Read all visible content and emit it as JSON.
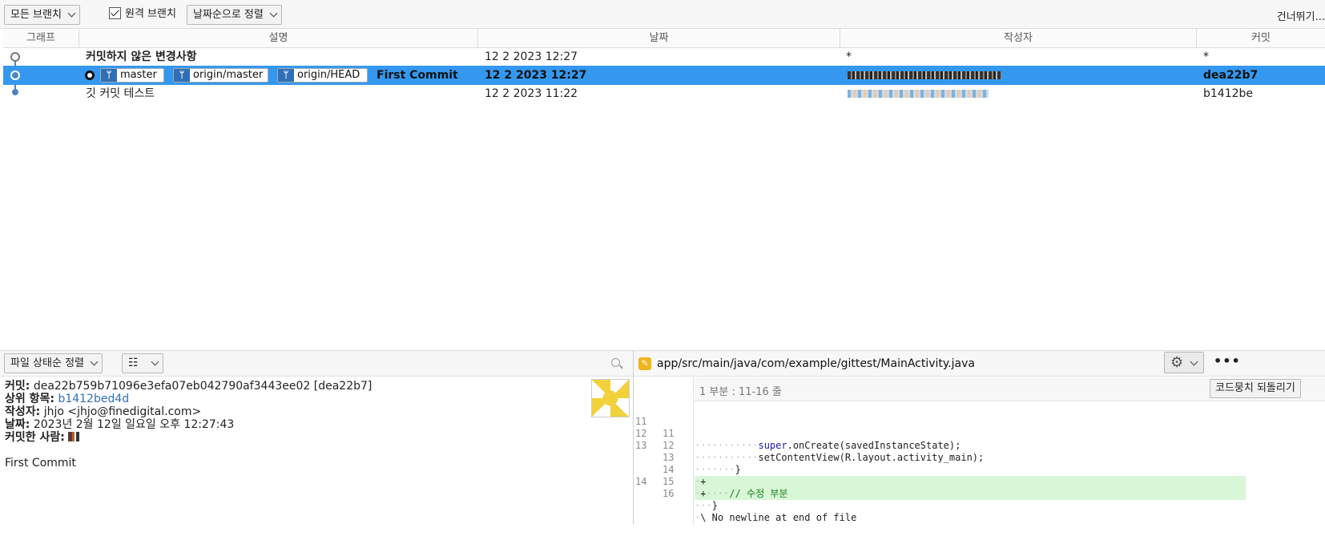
{
  "toolbar": {
    "branches_dropdown": "모든 브랜치",
    "remote_branches_label": "원격 브랜치",
    "sort_dropdown": "날짜순으로 정렬",
    "skip_label": "건너뛰기..."
  },
  "columns": {
    "graph": "그래프",
    "description": "설명",
    "date": "날짜",
    "author": "작성자",
    "commit": "커밋"
  },
  "commits": [
    {
      "description": "커밋하지 않은 변경사항",
      "date": "12 2 2023 12:27",
      "author": "*",
      "commit": "*"
    },
    {
      "refs": [
        "master",
        "origin/master",
        "origin/HEAD"
      ],
      "description": "First Commit",
      "date": "12 2 2023 12:27",
      "commit": "dea22b7"
    },
    {
      "description": "깃 커밋 테스트",
      "date": "12 2 2023 11:22",
      "commit": "b1412be"
    }
  ],
  "file_pane": {
    "sort_dropdown": "파일 상태순 정렬",
    "view_icon": "list-view-icon"
  },
  "details": {
    "commit_label": "커밋:",
    "commit_value": "dea22b759b71096e3efa07eb042790af3443ee02 [dea22b7]",
    "parent_label": "상위 항목:",
    "parent_value": "b1412bed4d",
    "author_label": "작성자:",
    "author_value": "jhjo <jhjo@finedigital.com>",
    "date_label": "날짜:",
    "date_value": "2023년 2월 12일 일요일 오후 12:27:43",
    "committer_label": "커밋한 사람:",
    "message": "First Commit"
  },
  "diff": {
    "file_path": "app/src/main/java/com/example/gittest/MainActivity.java",
    "hunk_title": "1 부분 : 11-16 줄",
    "revert_button": "코드뭉치 되돌리기",
    "more_label": "•••",
    "lines": [
      {
        "old": "11",
        "new": "11",
        "type": "ctx"
      },
      {
        "old": "12",
        "new": "12",
        "type": "ctx"
      },
      {
        "old": "13",
        "new": "13",
        "type": "ctx"
      },
      {
        "old": "",
        "new": "14",
        "type": "add"
      },
      {
        "old": "",
        "new": "15",
        "type": "add"
      },
      {
        "old": "14",
        "new": "16",
        "type": "ctx"
      },
      {
        "old": "",
        "new": "",
        "type": "ctx"
      }
    ],
    "code_super": "super",
    "code_oncreate": ".onCreate(savedInstanceState);",
    "code_setcontent": "setContentView(R.layout.activity_main);",
    "code_brace": "}",
    "code_plus": "+",
    "code_comment": "// 수정 부분",
    "code_nonewline": "\\ No newline at end of file"
  },
  "colors": {
    "selection": "#3498f0",
    "graph_line": "#4c86c4",
    "branch_badge": "#2f6fb7",
    "added_line": "#d7f7d7",
    "modified_file_icon": "#f0b41c"
  }
}
